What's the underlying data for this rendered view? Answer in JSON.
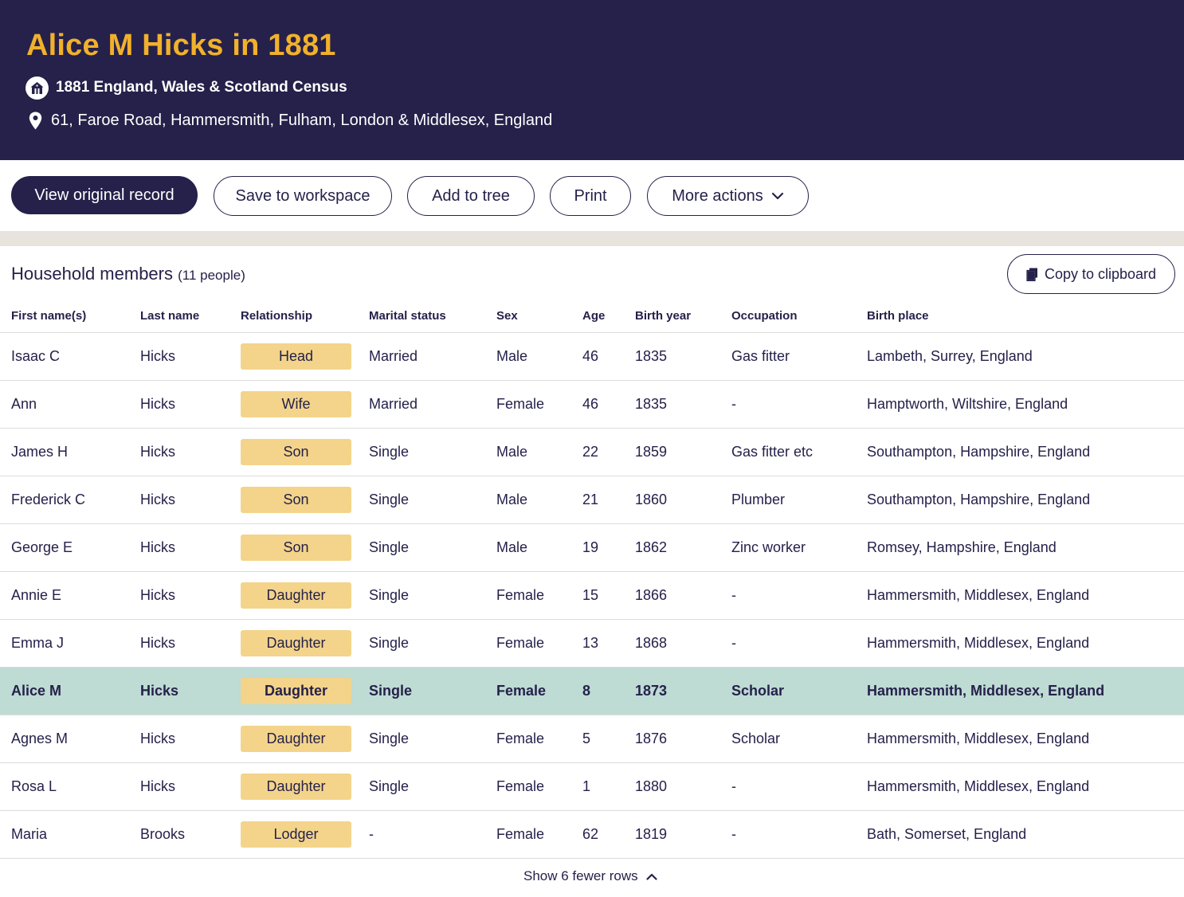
{
  "header": {
    "title": "Alice M Hicks in 1881",
    "census": "1881 England, Wales & Scotland Census",
    "census_icon": "house-icon",
    "address": "61, Faroe Road, Hammersmith, Fulham, London & Middlesex, England",
    "address_icon": "map-pin-icon"
  },
  "actions": {
    "view_original": "View original record",
    "save_workspace": "Save to workspace",
    "add_tree": "Add to tree",
    "print": "Print",
    "more_actions": "More actions"
  },
  "household": {
    "title": "Household members",
    "count": "(11 people)",
    "copy_label": "Copy to clipboard",
    "columns": [
      "First name(s)",
      "Last name",
      "Relationship",
      "Marital status",
      "Sex",
      "Age",
      "Birth year",
      "Occupation",
      "Birth place"
    ],
    "rows": [
      {
        "first": "Isaac C",
        "last": "Hicks",
        "relationship": "Head",
        "marital": "Married",
        "sex": "Male",
        "age": "46",
        "birth_year": "1835",
        "occupation": "Gas fitter",
        "birth_place": "Lambeth, Surrey, England"
      },
      {
        "first": "Ann",
        "last": "Hicks",
        "relationship": "Wife",
        "marital": "Married",
        "sex": "Female",
        "age": "46",
        "birth_year": "1835",
        "occupation": "-",
        "birth_place": "Hamptworth, Wiltshire, England"
      },
      {
        "first": "James H",
        "last": "Hicks",
        "relationship": "Son",
        "marital": "Single",
        "sex": "Male",
        "age": "22",
        "birth_year": "1859",
        "occupation": "Gas fitter etc",
        "birth_place": "Southampton, Hampshire, England"
      },
      {
        "first": "Frederick C",
        "last": "Hicks",
        "relationship": "Son",
        "marital": "Single",
        "sex": "Male",
        "age": "21",
        "birth_year": "1860",
        "occupation": "Plumber",
        "birth_place": "Southampton, Hampshire, England"
      },
      {
        "first": "George E",
        "last": "Hicks",
        "relationship": "Son",
        "marital": "Single",
        "sex": "Male",
        "age": "19",
        "birth_year": "1862",
        "occupation": "Zinc worker",
        "birth_place": "Romsey, Hampshire, England"
      },
      {
        "first": "Annie E",
        "last": "Hicks",
        "relationship": "Daughter",
        "marital": "Single",
        "sex": "Female",
        "age": "15",
        "birth_year": "1866",
        "occupation": "-",
        "birth_place": "Hammersmith, Middlesex, England"
      },
      {
        "first": "Emma J",
        "last": "Hicks",
        "relationship": "Daughter",
        "marital": "Single",
        "sex": "Female",
        "age": "13",
        "birth_year": "1868",
        "occupation": "-",
        "birth_place": "Hammersmith, Middlesex, England"
      },
      {
        "first": "Alice M",
        "last": "Hicks",
        "relationship": "Daughter",
        "marital": "Single",
        "sex": "Female",
        "age": "8",
        "birth_year": "1873",
        "occupation": "Scholar",
        "birth_place": "Hammersmith, Middlesex, England"
      },
      {
        "first": "Agnes M",
        "last": "Hicks",
        "relationship": "Daughter",
        "marital": "Single",
        "sex": "Female",
        "age": "5",
        "birth_year": "1876",
        "occupation": "Scholar",
        "birth_place": "Hammersmith, Middlesex, England"
      },
      {
        "first": "Rosa L",
        "last": "Hicks",
        "relationship": "Daughter",
        "marital": "Single",
        "sex": "Female",
        "age": "1",
        "birth_year": "1880",
        "occupation": "-",
        "birth_place": "Hammersmith, Middlesex, England"
      },
      {
        "first": "Maria",
        "last": "Brooks",
        "relationship": "Lodger",
        "marital": "-",
        "sex": "Female",
        "age": "62",
        "birth_year": "1819",
        "occupation": "-",
        "birth_place": "Bath, Somerset, England"
      }
    ],
    "highlighted_row": 7,
    "show_fewer": "Show 6 fewer rows"
  },
  "colors": {
    "header_bg": "#25214a",
    "title": "#f2b12b",
    "pill": "#f3d48a",
    "highlight_row": "#bedbd4",
    "band": "#e8e3dc"
  }
}
